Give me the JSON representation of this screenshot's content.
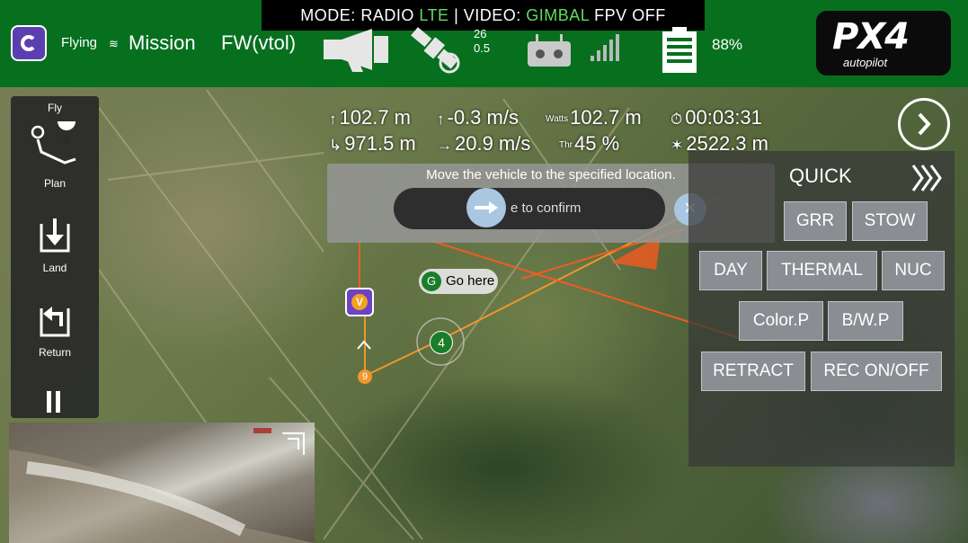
{
  "mode_strip": {
    "mode_label": "MODE:",
    "link1": "RADIO",
    "link2": "LTE",
    "separator": "|",
    "video_label": "VIDEO:",
    "video1": "GIMBAL",
    "video2": "FPV",
    "video3": "OFF",
    "active_color": "#5fdc5f"
  },
  "toolbar": {
    "flight_state": "Flying",
    "flight_mode": "Mission",
    "vehicle_type": "FW(vtol)",
    "gps_count": "26",
    "gps_hdop": "0.5",
    "battery": "88%",
    "icons": [
      "app-logo-icon",
      "megaphone-icon",
      "satellite-icon",
      "rc-transmitter-icon",
      "signal-bars-icon",
      "battery-icon",
      "px4-logo"
    ]
  },
  "logo": {
    "brand": "PX4",
    "tagline": "autopilot"
  },
  "telemetry": {
    "altitude": "102.7 m",
    "vspeed": "-0.3 m/s",
    "watts_label": "Watts",
    "watts": "102.7 m",
    "flight_time": "00:03:31",
    "distance": "971.5 m",
    "gspeed": "20.9 m/s",
    "thr_label": "Thr",
    "throttle": "45 %",
    "total_distance": "2522.3 m"
  },
  "left_panel": {
    "fly": "Fly",
    "plan": "Plan",
    "land": "Land",
    "return": "Return"
  },
  "guided_action": {
    "message": "Move the vehicle to the specified location.",
    "slider_text": "e to confirm"
  },
  "quick_panel": {
    "title": "QUICK",
    "buttons": {
      "grr": "GRR",
      "stow": "STOW",
      "day": "DAY",
      "thermal": "THERMAL",
      "nuc": "NUC",
      "colorp": "Color.P",
      "bwp": "B/W.P",
      "retract": "RETRACT",
      "rec": "REC ON/OFF"
    }
  },
  "map": {
    "goto_marker": "G",
    "goto_label": "Go here",
    "waypoint4": "4",
    "waypoint9": "9",
    "vehicle": "V",
    "path_color": "#f0962a",
    "track_color": "#ff5a1e"
  }
}
